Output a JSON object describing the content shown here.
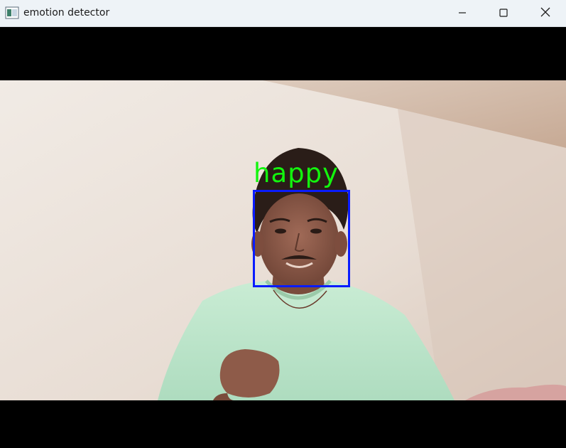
{
  "window": {
    "title": "emotion detector",
    "controls": {
      "minimize": "minimize-icon",
      "maximize": "maximize-icon",
      "close": "close-icon"
    }
  },
  "detection": {
    "label": "happy",
    "label_color": "#13f50e",
    "box_color": "#0a1cff"
  }
}
